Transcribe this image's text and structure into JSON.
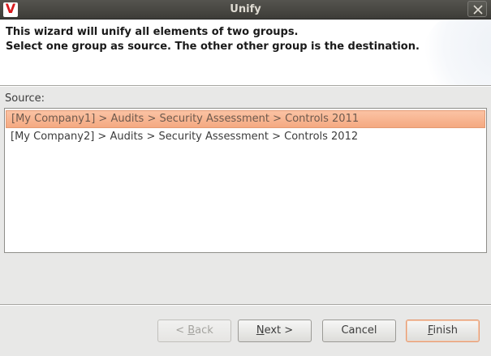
{
  "window": {
    "title": "Unify",
    "app_icon_letter": "V",
    "close_icon": "close-icon"
  },
  "header": {
    "line1": "This wizard will unify all elements of two groups.",
    "line2": "Select one group as source. The other other group is the destination."
  },
  "source": {
    "label": "Source:",
    "items": [
      {
        "text": "[My Company1] > Audits > Security Assessment > Controls 2011",
        "selected": true
      },
      {
        "text": "[My Company2] > Audits > Security Assessment > Controls 2012",
        "selected": false
      }
    ]
  },
  "buttons": {
    "back": {
      "prefix": "< ",
      "mnemonic": "B",
      "rest": "ack",
      "enabled": false
    },
    "next": {
      "prefix": "",
      "mnemonic": "N",
      "rest": "ext >",
      "enabled": true
    },
    "cancel": {
      "label": "Cancel",
      "enabled": true
    },
    "finish": {
      "prefix": "",
      "mnemonic": "F",
      "rest": "inish",
      "enabled": true,
      "default": true
    }
  },
  "colors": {
    "titlebar": "#3d3c38",
    "selection": "#f4a981",
    "brand_red": "#d7191c"
  }
}
